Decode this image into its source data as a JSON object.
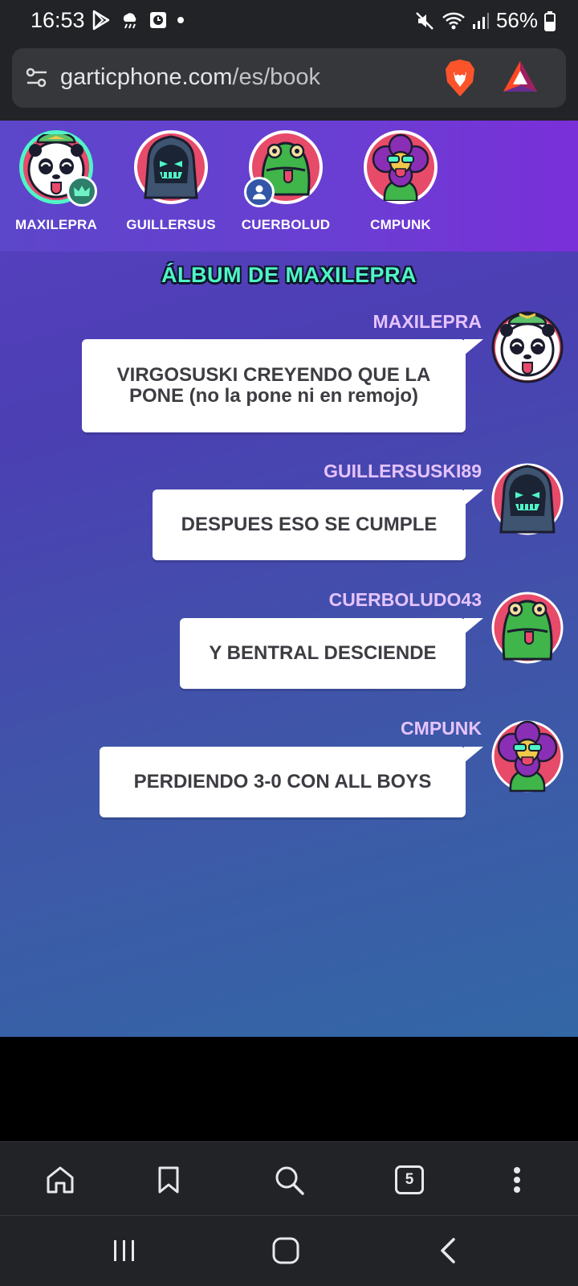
{
  "status_bar": {
    "time": "16:53",
    "battery": "56%"
  },
  "browser": {
    "url_domain": "garticphone.com",
    "url_path": "/es/book",
    "tab_count": "5"
  },
  "players": [
    {
      "name": "MAXILEPRA",
      "badge": "crown-icon"
    },
    {
      "name": "GUILLERSUS",
      "badge": ""
    },
    {
      "name": "CUERBOLUD",
      "badge": "user-icon"
    },
    {
      "name": "CMPUNK",
      "badge": ""
    }
  ],
  "album": {
    "title": "ÁLBUM DE MAXILEPRA"
  },
  "messages": [
    {
      "author": "MAXILEPRA",
      "text_line1": "VIRGOSUSKI CREYENDO QUE LA",
      "text_line2": "PONE (no la pone ni en remojo)"
    },
    {
      "author": "GUILLERSUSKI89",
      "text": "DESPUES ESO SE CUMPLE"
    },
    {
      "author": "CUERBOLUDO43",
      "text": "Y BENTRAL DESCIENDE"
    },
    {
      "author": "CMPUNK",
      "text": "PERDIENDO 3-0 CON ALL BOYS"
    }
  ],
  "colors": {
    "title_green": "#4ff5c7",
    "author_purple": "#e6c3ff",
    "bg_top": "#5a3fc2",
    "bg_bottom": "#3367a6"
  }
}
